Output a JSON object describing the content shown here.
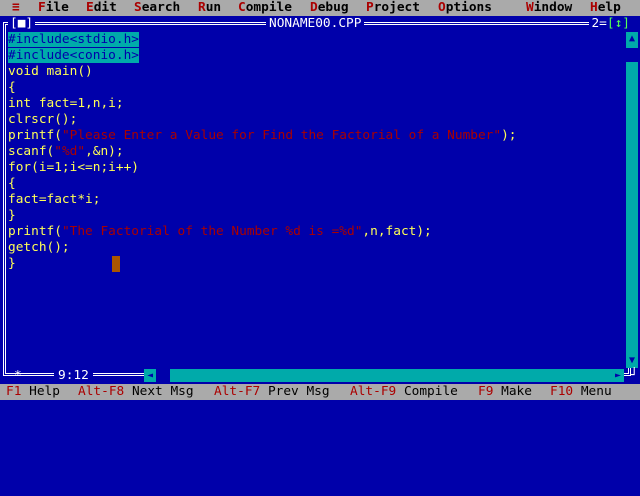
{
  "menubar": {
    "system": "≡",
    "items": [
      {
        "hotkey": "F",
        "rest": "ile"
      },
      {
        "hotkey": "E",
        "rest": "dit"
      },
      {
        "hotkey": "S",
        "rest": "earch"
      },
      {
        "hotkey": "R",
        "rest": "un"
      },
      {
        "hotkey": "C",
        "rest": "ompile"
      },
      {
        "hotkey": "D",
        "rest": "ebug"
      },
      {
        "hotkey": "P",
        "rest": "roject"
      },
      {
        "hotkey": "O",
        "rest": "ptions"
      },
      {
        "hotkey": "W",
        "rest": "indow"
      },
      {
        "hotkey": "H",
        "rest": "elp"
      }
    ]
  },
  "editor": {
    "title": "NONAME00.CPP",
    "close_box": "[■]",
    "window_number": "2",
    "zoom_box": "[↕]",
    "cursor_position": "9:12",
    "lines": [
      {
        "parts": [
          {
            "t": "#include<stdio.h>",
            "c": "hl"
          }
        ]
      },
      {
        "parts": [
          {
            "t": "#include<conio.h>",
            "c": "hl"
          }
        ]
      },
      {
        "parts": [
          {
            "t": "void main()",
            "c": ""
          }
        ]
      },
      {
        "parts": [
          {
            "t": "{",
            "c": ""
          }
        ]
      },
      {
        "parts": [
          {
            "t": "int fact=1,n,i;",
            "c": ""
          }
        ]
      },
      {
        "parts": [
          {
            "t": "clrscr();",
            "c": ""
          }
        ]
      },
      {
        "parts": [
          {
            "t": "printf(",
            "c": ""
          },
          {
            "t": "\"Please Enter a Value for Find the Factorial of a Number\"",
            "c": "str"
          },
          {
            "t": ");",
            "c": ""
          }
        ]
      },
      {
        "parts": [
          {
            "t": "scanf(",
            "c": ""
          },
          {
            "t": "\"%d\"",
            "c": "str"
          },
          {
            "t": ",&n);",
            "c": ""
          }
        ]
      },
      {
        "parts": [
          {
            "t": "for(i=1;i<=n;i++)",
            "c": ""
          }
        ]
      },
      {
        "parts": [
          {
            "t": "{",
            "c": ""
          }
        ]
      },
      {
        "parts": [
          {
            "t": "fact=fact*i;",
            "c": ""
          }
        ]
      },
      {
        "parts": [
          {
            "t": "}",
            "c": ""
          }
        ]
      },
      {
        "parts": [
          {
            "t": "printf(",
            "c": ""
          },
          {
            "t": "\"The Factorial of the Number %d is =%d\"",
            "c": "str"
          },
          {
            "t": ",n,fact);",
            "c": ""
          }
        ]
      },
      {
        "parts": [
          {
            "t": "getch();",
            "c": ""
          }
        ]
      },
      {
        "parts": [
          {
            "t": "}",
            "c": ""
          }
        ]
      }
    ]
  },
  "statusbar": {
    "items": [
      {
        "key": "F1",
        "label": " Help"
      },
      {
        "key": "Alt-F8",
        "label": " Next Msg"
      },
      {
        "key": "Alt-F7",
        "label": " Prev Msg"
      },
      {
        "key": "Alt-F9",
        "label": " Compile"
      },
      {
        "key": "F9",
        "label": " Make"
      },
      {
        "key": "F10",
        "label": " Menu"
      }
    ]
  },
  "colors": {
    "background": "#0000aa",
    "code_text": "#ffff55",
    "string_text": "#aa0000",
    "highlight_bg": "#00aaaa",
    "menu_bg": "#aaaaaa",
    "hotkey": "#aa0000"
  },
  "icons": {
    "scroll_up": "▲",
    "scroll_down": "▼",
    "scroll_left": "◄",
    "scroll_right": "►",
    "resize_corner": "┘",
    "move_mark": "*"
  }
}
